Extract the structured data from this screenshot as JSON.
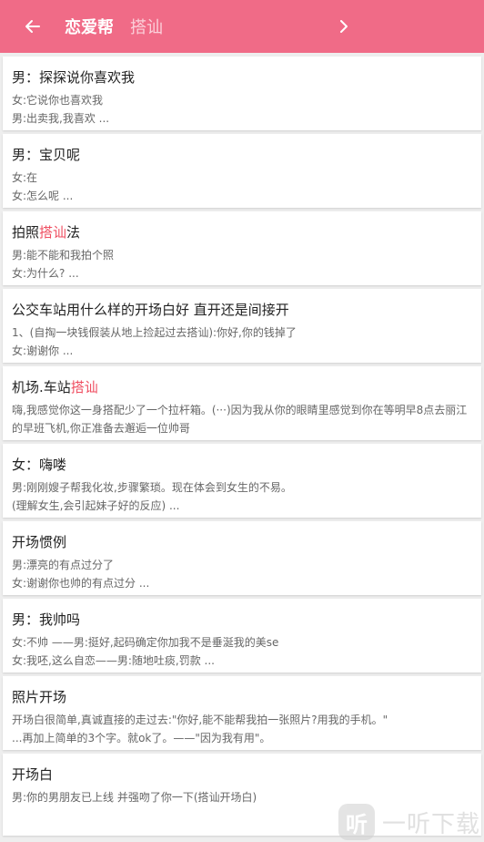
{
  "header": {
    "back_icon": "arrow-left-icon",
    "app_title": "恋爱帮",
    "query": "搭讪",
    "go_icon": "chevron-right-icon",
    "bg_color": "#f06b87"
  },
  "highlight_color": "#ef4e61",
  "cards": [
    {
      "title_parts": {
        "pre": "男：探探说你喜欢我",
        "hl": "",
        "post": ""
      },
      "lines": [
        "女:它说你也喜欢我",
        "男:出卖我,我喜欢 ..."
      ]
    },
    {
      "title_parts": {
        "pre": "男：宝贝呢",
        "hl": "",
        "post": ""
      },
      "lines": [
        "女:在",
        "女:怎么呢 ..."
      ]
    },
    {
      "title_parts": {
        "pre": "拍照",
        "hl": "搭讪",
        "post": "法"
      },
      "lines": [
        "男:能不能和我拍个照",
        "女:为什么? ..."
      ]
    },
    {
      "title_parts": {
        "pre": "公交车站用什么样的开场白好 直开还是间接开",
        "hl": "",
        "post": ""
      },
      "lines": [
        "1、(自掏一块钱假装从地上捡起过去搭讪):你好,你的钱掉了",
        "女:谢谢你 ..."
      ]
    },
    {
      "title_parts": {
        "pre": "机场.车站",
        "hl": "搭讪",
        "post": ""
      },
      "lines": [
        "嗨,我感觉你这一身搭配少了一个拉杆箱。(···)因为我从你的眼睛里感觉到你在等明早8点去丽江的早班飞机,你正准备去邂逅一位帅哥"
      ]
    },
    {
      "title_parts": {
        "pre": "女：嗨喽",
        "hl": "",
        "post": ""
      },
      "lines": [
        "男:刚刚嫂子帮我化妆,步骤繁琐。现在体会到女生的不易。",
        "(理解女生,会引起妹子好的反应) ..."
      ]
    },
    {
      "title_parts": {
        "pre": "开场惯例",
        "hl": "",
        "post": ""
      },
      "lines": [
        "男:漂亮的有点过分了",
        "女:谢谢你也帅的有点过分 ..."
      ]
    },
    {
      "title_parts": {
        "pre": "男：我帅吗",
        "hl": "",
        "post": ""
      },
      "lines": [
        "女:不帅 ——男:挺好,起码确定你加我不是垂涎我的美se",
        "女:我呸,这么自恋——男:随地吐痰,罚款 ..."
      ]
    },
    {
      "title_parts": {
        "pre": "照片开场",
        "hl": "",
        "post": ""
      },
      "lines": [
        "开场白很简单,真诚直接的走过去:\"你好,能不能帮我拍一张照片?用我的手机。\"",
        "...再加上简单的3个字。就ok了。——\"因为我有用\"。"
      ]
    },
    {
      "title_parts": {
        "pre": "开场白",
        "hl": "",
        "post": ""
      },
      "lines": [
        "男:你的男朋友已上线 并强吻了你一下(搭讪开场白)"
      ]
    }
  ],
  "watermark": {
    "icon_text": "听",
    "text": "一听下载"
  }
}
